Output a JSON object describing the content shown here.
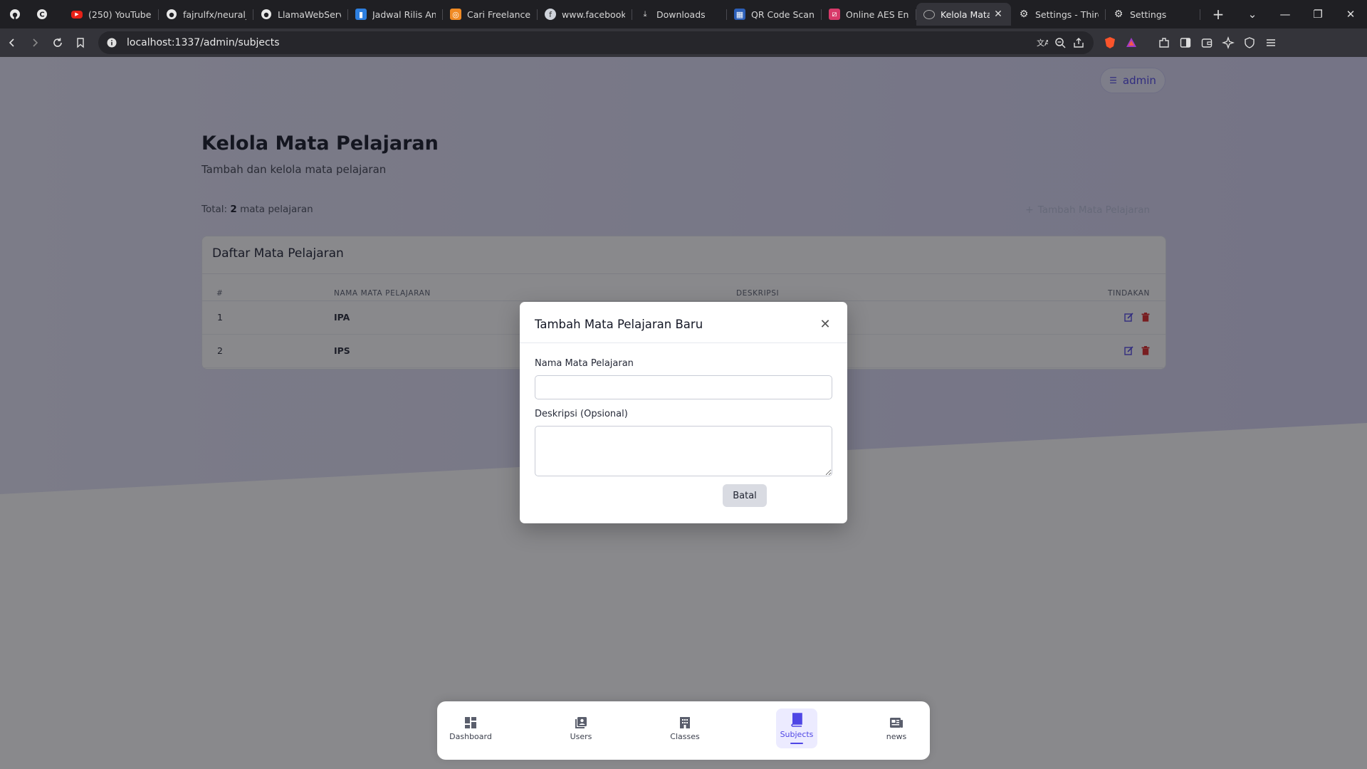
{
  "browser": {
    "tabs": [
      {
        "label": "(250) YouTube",
        "icon": "youtube-icon"
      },
      {
        "label": "fajrulfx/neural_n",
        "icon": "github-icon"
      },
      {
        "label": "LlamaWebServe",
        "icon": "github-icon"
      },
      {
        "label": "Jadwal Rilis Anin",
        "icon": "bookmark-site-icon"
      },
      {
        "label": "Cari Freelancer I",
        "icon": "freelancer-icon"
      },
      {
        "label": "www.facebook.c",
        "icon": "facebook-icon"
      },
      {
        "label": "Downloads",
        "icon": "download-icon"
      },
      {
        "label": "QR Code Scann",
        "icon": "qr-icon"
      },
      {
        "label": "Online AES Encr",
        "icon": "aes-icon"
      },
      {
        "label": "Kelola Mata",
        "icon": "site-icon",
        "active": true
      },
      {
        "label": "Settings - Third",
        "icon": "gear-icon"
      },
      {
        "label": "Settings",
        "icon": "gear-icon"
      }
    ],
    "url": "localhost:1337/admin/subjects"
  },
  "page": {
    "user_label": "admin",
    "title": "Kelola Mata Pelajaran",
    "subtitle": "Tambah dan kelola mata pelajaran",
    "total_prefix": "Total:",
    "total_count": "2",
    "total_suffix": "mata pelajaran",
    "add_button": "Tambah Mata Pelajaran",
    "accent": "#4f46e5"
  },
  "table": {
    "title": "Daftar Mata Pelajaran",
    "headers": [
      "#",
      "NAMA MATA PELAJARAN",
      "DESKRIPSI",
      "TINDAKAN"
    ],
    "rows": [
      {
        "no": "1",
        "name": "IPA"
      },
      {
        "no": "2",
        "name": "IPS"
      }
    ]
  },
  "modal": {
    "title": "Tambah Mata Pelajaran Baru",
    "name_label": "Nama Mata Pelajaran",
    "name_value": "",
    "desc_label": "Deskripsi (Opsional)",
    "desc_value": "",
    "cancel": "Batal"
  },
  "bottom_nav": [
    {
      "label": "Dashboard",
      "icon": "dashboard-icon"
    },
    {
      "label": "Users",
      "icon": "users-icon"
    },
    {
      "label": "Classes",
      "icon": "classes-icon"
    },
    {
      "label": "Subjects",
      "icon": "subjects-icon",
      "active": true
    },
    {
      "label": "news",
      "icon": "news-icon"
    }
  ]
}
